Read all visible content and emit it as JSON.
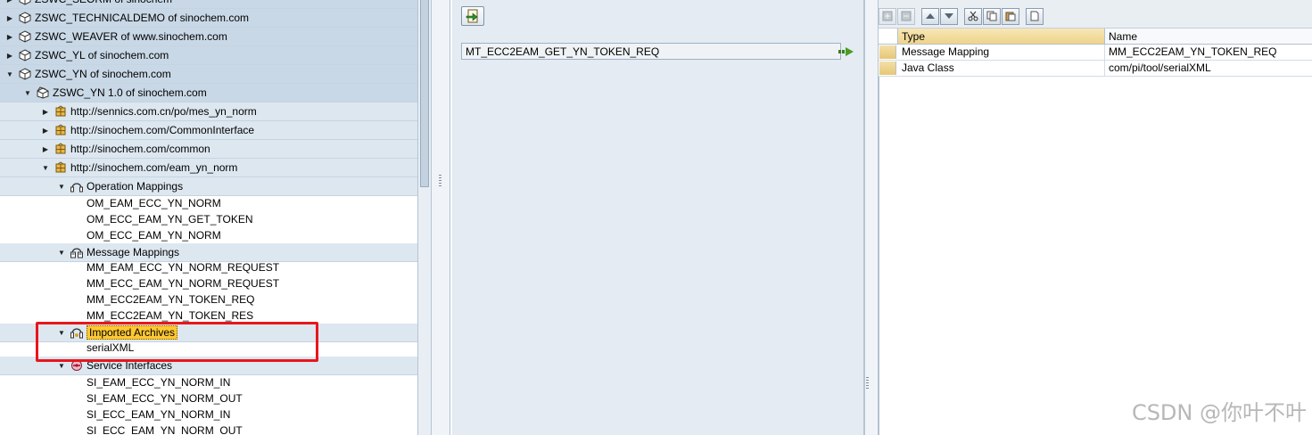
{
  "tree": {
    "items": [
      {
        "label": "ZSWC_SEORM of sinochem",
        "toggle": "▶",
        "icon": "package-icon",
        "type": "swcv"
      },
      {
        "label": "ZSWC_TECHNICALDEMO of sinochem.com",
        "toggle": "▶",
        "icon": "package-icon",
        "type": "swcv"
      },
      {
        "label": "ZSWC_WEAVER of www.sinochem.com",
        "toggle": "▶",
        "icon": "package-icon",
        "type": "swcv"
      },
      {
        "label": "ZSWC_YL of sinochem.com",
        "toggle": "▶",
        "icon": "package-icon",
        "type": "swcv"
      },
      {
        "label": "ZSWC_YN of sinochem.com",
        "toggle": "▼",
        "icon": "package-icon",
        "type": "swcv"
      },
      {
        "label": "ZSWC_YN 1.0 of sinochem.com",
        "toggle": "▼",
        "icon": "package-open-icon",
        "type": "version"
      },
      {
        "label": "http://sennics.com.cn/po/mes_yn_norm",
        "toggle": "▶",
        "icon": "namespace-icon",
        "type": "ns"
      },
      {
        "label": "http://sinochem.com/CommonInterface",
        "toggle": "▶",
        "icon": "namespace-icon",
        "type": "ns"
      },
      {
        "label": "http://sinochem.com/common",
        "toggle": "▶",
        "icon": "namespace-icon",
        "type": "ns"
      },
      {
        "label": "http://sinochem.com/eam_yn_norm",
        "toggle": "▼",
        "icon": "namespace-icon",
        "type": "ns"
      },
      {
        "label": "Operation Mappings",
        "toggle": "▼",
        "icon": "operation-mapping-icon",
        "type": "category"
      },
      {
        "label": "OM_EAM_ECC_YN_NORM",
        "type": "leaf"
      },
      {
        "label": "OM_ECC_EAM_YN_GET_TOKEN",
        "type": "leaf"
      },
      {
        "label": "OM_ECC_EAM_YN_NORM",
        "type": "leaf"
      },
      {
        "label": "Message Mappings",
        "toggle": "▼",
        "icon": "message-mapping-icon",
        "type": "category"
      },
      {
        "label": "MM_EAM_ECC_YN_NORM_REQUEST",
        "type": "leaf"
      },
      {
        "label": "MM_ECC_EAM_YN_NORM_REQUEST",
        "type": "leaf"
      },
      {
        "label": "MM_ECC2EAM_YN_TOKEN_REQ",
        "type": "leaf"
      },
      {
        "label": "MM_ECC2EAM_YN_TOKEN_RES",
        "type": "leaf"
      },
      {
        "label": "Imported Archives",
        "toggle": "▼",
        "icon": "imported-archive-icon",
        "type": "category",
        "selected": true
      },
      {
        "label": "serialXML",
        "type": "leaf"
      },
      {
        "label": "Service Interfaces",
        "toggle": "▼",
        "icon": "service-interface-icon",
        "type": "category"
      },
      {
        "label": "SI_EAM_ECC_YN_NORM_IN",
        "type": "leaf"
      },
      {
        "label": "SI_EAM_ECC_YN_NORM_OUT",
        "type": "leaf"
      },
      {
        "label": "SI_ECC_EAM_YN_NORM_IN",
        "type": "leaf"
      },
      {
        "label": "SI_ECC_EAM_YN_NORM_OUT",
        "type": "leaf"
      }
    ]
  },
  "middle": {
    "source_message_value": "MT_ECC2EAM_GET_YN_TOKEN_REQ"
  },
  "right": {
    "columns": [
      "Type",
      "Name"
    ],
    "rows": [
      {
        "type": "Message Mapping",
        "name": "MM_ECC2EAM_YN_TOKEN_REQ"
      },
      {
        "type": "Java Class",
        "name": "com/pi/tool/serialXML"
      }
    ]
  },
  "watermark": "CSDN @你叶不叶",
  "colors": {
    "selection_highlight": "#ffc832",
    "annotation_box": "#e8161b",
    "panel_blue": "#dde7f0"
  }
}
